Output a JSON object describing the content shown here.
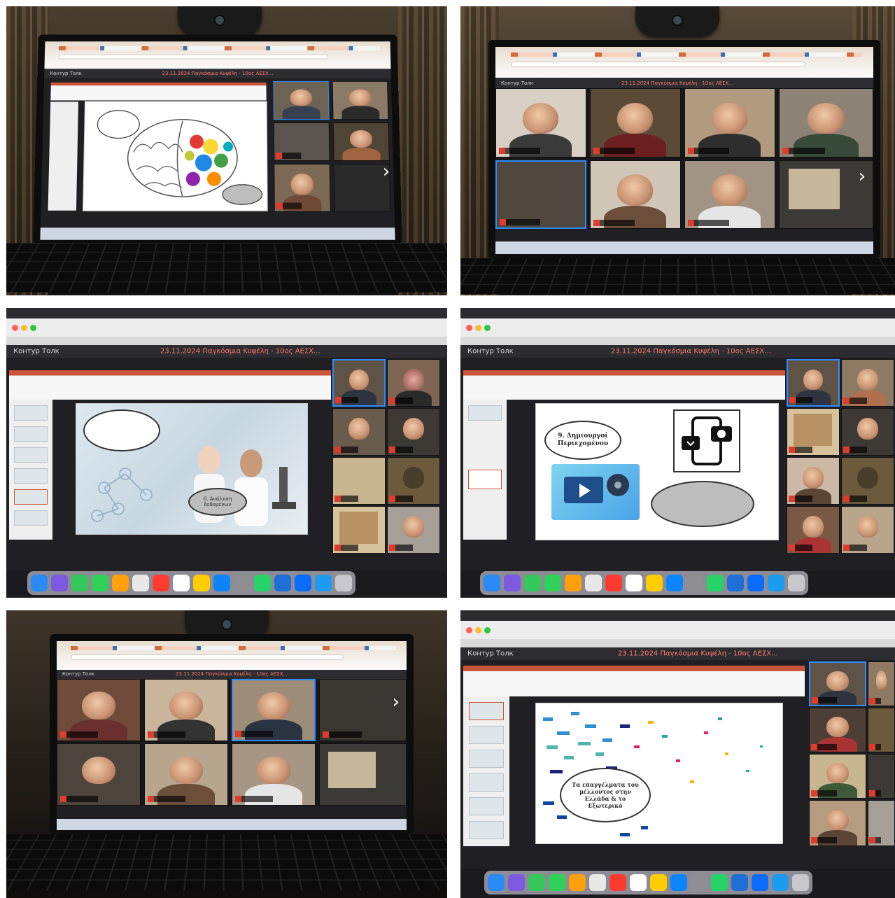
{
  "conference": {
    "app_name": "Контур Толк",
    "meeting_title": "23.11.2024 Παγκόσμια Κυψέλη - 10ος ΑΕΣΧ..."
  },
  "slides": {
    "neurons": "6. Ανάλυση δεδομένων",
    "content_creation": "9. Δημιουργοί Περιεχομένου",
    "professions": "Τα επαγγέλματα του μέλλοντος στην Ελλάδα & το Εξωτερικό"
  },
  "colors": {
    "zoom_brand": "#2d8cff",
    "record_red": "#e03b2b",
    "ppt_orange": "#c9563a",
    "taskbar_blue": "#1f6fd6"
  },
  "photos": [
    {
      "id": "photo-1",
      "scene": "laptop-powerpoint-brain"
    },
    {
      "id": "photo-2",
      "scene": "laptop-video-grid"
    },
    {
      "id": "photo-3",
      "scene": "mac-powerpoint-lab"
    },
    {
      "id": "photo-4",
      "scene": "mac-powerpoint-content-creators"
    },
    {
      "id": "photo-5",
      "scene": "laptop-video-grid"
    },
    {
      "id": "photo-6",
      "scene": "mac-powerpoint-professions"
    }
  ]
}
